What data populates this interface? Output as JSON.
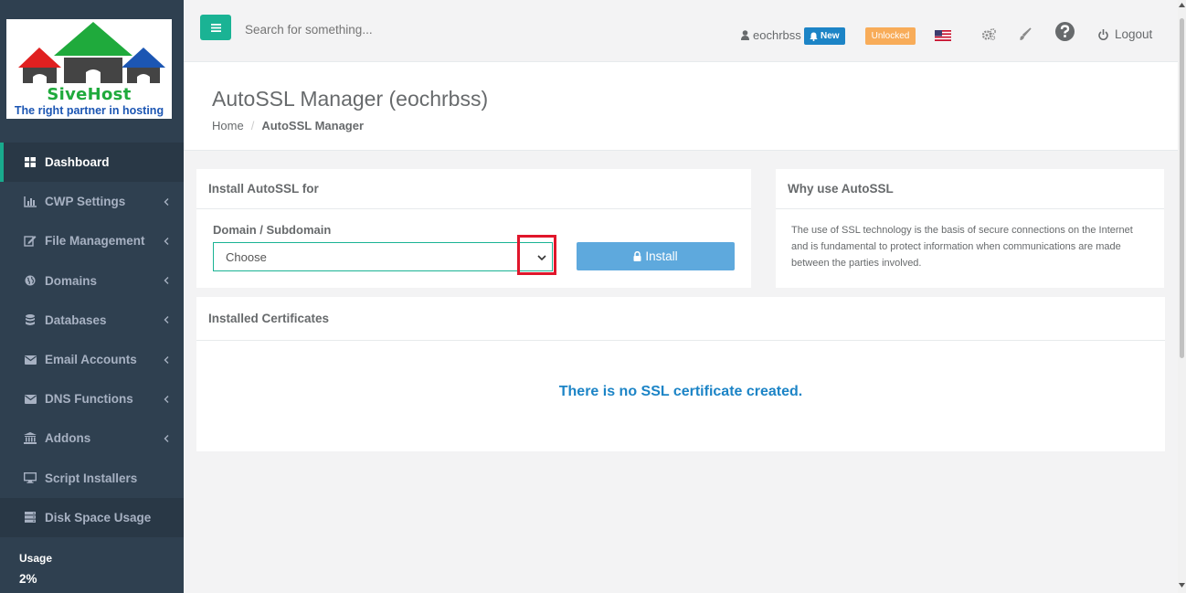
{
  "logo": {
    "title": "SiveHost",
    "tagline": "The right partner in hosting"
  },
  "sidebar": {
    "items": [
      {
        "label": "Dashboard",
        "icon": "dashboard-icon"
      },
      {
        "label": "CWP Settings",
        "icon": "bar-chart-icon"
      },
      {
        "label": "File Management",
        "icon": "edit-icon"
      },
      {
        "label": "Domains",
        "icon": "globe-icon"
      },
      {
        "label": "Databases",
        "icon": "database-icon"
      },
      {
        "label": "Email Accounts",
        "icon": "envelope-icon"
      },
      {
        "label": "DNS Functions",
        "icon": "envelope-icon"
      },
      {
        "label": "Addons",
        "icon": "bank-icon"
      },
      {
        "label": "Script Installers",
        "icon": "monitor-icon"
      },
      {
        "label": "Disk Space Usage",
        "icon": "server-icon"
      }
    ],
    "usage_label": "Usage",
    "usage_value": "2%"
  },
  "topbar": {
    "search_placeholder": "Search for something...",
    "username": "eochrbss",
    "new_badge": "New",
    "unlocked_badge": "Unlocked",
    "logout": "Logout"
  },
  "page": {
    "title": "AutoSSL Manager (eochrbss)",
    "breadcrumb_home": "Home",
    "breadcrumb_sep": "/",
    "breadcrumb_current": "AutoSSL Manager"
  },
  "install_panel": {
    "heading": "Install AutoSSL for",
    "field_label": "Domain / Subdomain",
    "select_value": "Choose",
    "install_button": "Install"
  },
  "why_panel": {
    "heading": "Why use AutoSSL",
    "text": "The use of SSL technology is the basis of secure connections on the Internet and is fundamental to protect information when communications are made between the parties involved."
  },
  "certs_panel": {
    "heading": "Installed Certificates",
    "empty_message": "There is no SSL certificate created."
  },
  "colors": {
    "sidebar_bg": "#2f4050",
    "accent_green": "#1ab394",
    "primary_blue": "#1c84c6",
    "install_button": "#5ea9dd",
    "warning_orange": "#f8ac59",
    "highlight_red": "#e0162b"
  }
}
